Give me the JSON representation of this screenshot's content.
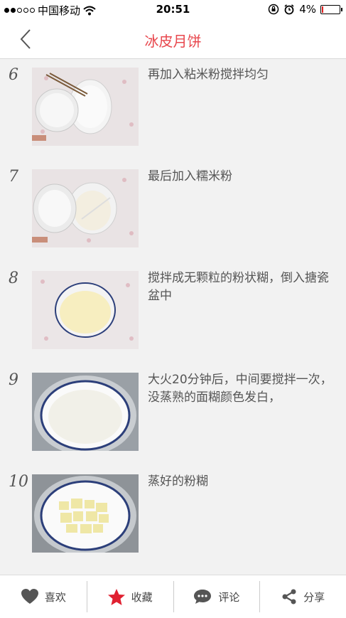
{
  "status": {
    "carrier": "中国移动",
    "time": "20:51",
    "battery": "4%",
    "battery_level": 0.04,
    "icons": [
      "signal-dots-icon",
      "wifi-icon",
      "rotation-lock-icon",
      "alarm-icon",
      "battery-icon"
    ]
  },
  "nav": {
    "title": "冰皮月饼",
    "back_icon": "back-chevron-icon"
  },
  "steps": [
    {
      "num": "6",
      "text": "再加入粘米粉搅拌均匀"
    },
    {
      "num": "7",
      "text": "最后加入糯米粉"
    },
    {
      "num": "8",
      "text": "搅拌成无颗粒的粉状糊，倒入搪瓷盆中"
    },
    {
      "num": "9",
      "text": "大火20分钟后，中间要搅拌一次，没蒸熟的面糊颜色发白，"
    },
    {
      "num": "10",
      "text": "蒸好的粉糊"
    }
  ],
  "tabbar": {
    "like": "喜欢",
    "favorite": "收藏",
    "comment": "评论",
    "share": "分享"
  },
  "colors": {
    "accent": "#e8484e",
    "star": "#e02030",
    "icon": "#555555"
  }
}
